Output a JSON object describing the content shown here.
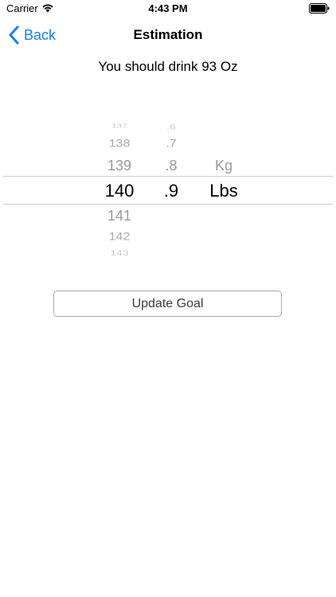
{
  "status_bar": {
    "carrier": "Carrier",
    "time": "4:43 PM",
    "wifi_icon": "wifi-icon",
    "battery_icon": "battery-icon"
  },
  "nav": {
    "back_label": "Back",
    "back_icon": "chevron-left-icon",
    "title": "Estimation"
  },
  "message": "You should drink 93 Oz",
  "picker": {
    "number_items": [
      "137",
      "138",
      "139",
      "140",
      "141",
      "142",
      "143"
    ],
    "decimal_items": [
      ".6",
      ".7",
      ".8",
      ".9"
    ],
    "unit_items": [
      "Kg",
      "Lbs"
    ],
    "selected": {
      "number": "140",
      "decimal": ".9",
      "unit": "Lbs"
    }
  },
  "update_button_label": "Update Goal",
  "colors": {
    "accent": "#1a7ff0",
    "picker_line": "#d0d0d4",
    "button_border": "#a9a9ae"
  }
}
